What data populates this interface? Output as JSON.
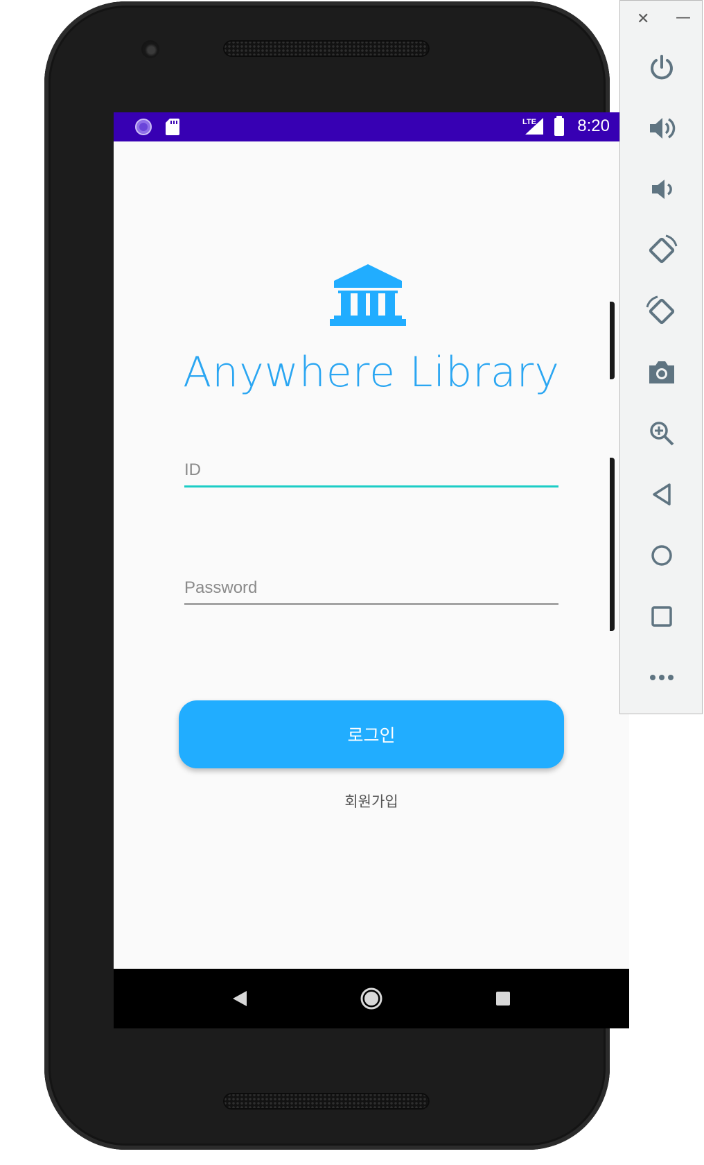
{
  "status_bar": {
    "network": "LTE",
    "time": "8:20",
    "left_icons": [
      "sync-icon",
      "sd-card-icon"
    ],
    "background": "#3700b3"
  },
  "app": {
    "logo_icon": "library-bank-icon",
    "title": "Anywhere Library",
    "accent_color": "#21adff"
  },
  "form": {
    "id_field": {
      "placeholder": "ID",
      "value": ""
    },
    "password_field": {
      "placeholder": "Password",
      "value": ""
    },
    "login_label": "로그인",
    "signup_label": "회원가입"
  },
  "nav_bar": {
    "buttons": [
      "back-icon",
      "home-icon",
      "recents-icon"
    ]
  },
  "emulator_toolbar": {
    "window_controls": [
      "close-icon",
      "minimize-icon"
    ],
    "buttons": [
      "power-icon",
      "volume-up-icon",
      "volume-down-icon",
      "rotate-left-icon",
      "rotate-right-icon",
      "camera-icon",
      "zoom-icon",
      "back-icon",
      "home-icon",
      "overview-icon",
      "more-icon"
    ]
  }
}
